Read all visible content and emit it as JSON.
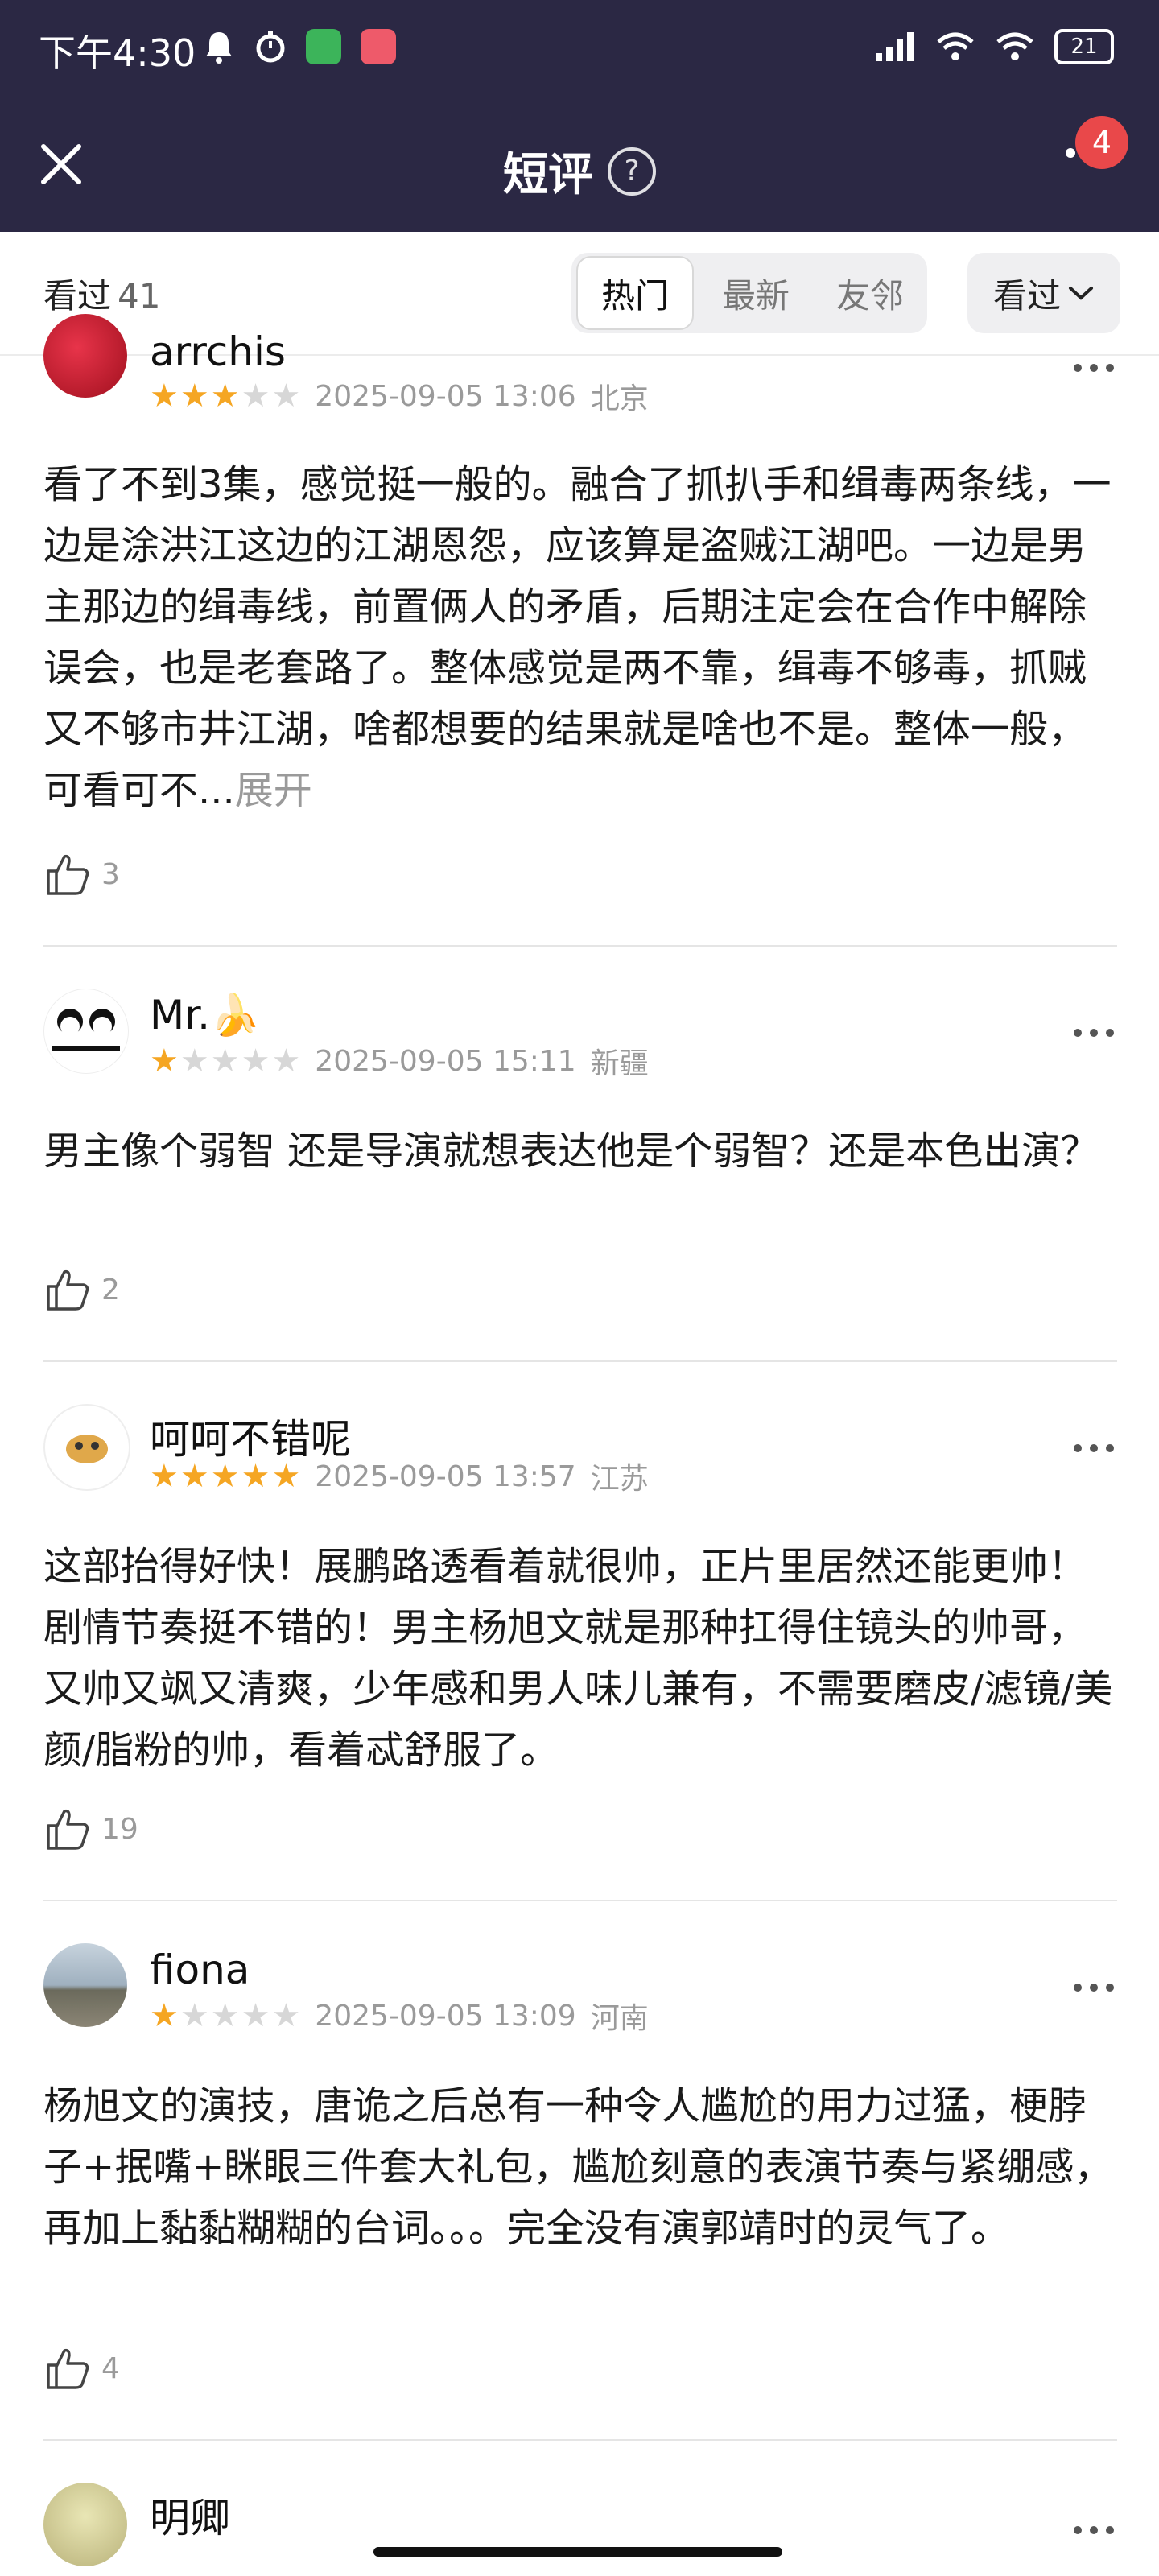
{
  "status_bar": {
    "time": "下午4:30",
    "battery": "21"
  },
  "header": {
    "title": "短评",
    "help": "?",
    "notification_count": "4"
  },
  "filter": {
    "seen_label": "看过",
    "seen_count": "41",
    "tabs": [
      "热门",
      "最新",
      "友邻"
    ],
    "active_tab": "热门",
    "dropdown_label": "看过"
  },
  "reviews": [
    {
      "name": "arrchis",
      "rating": 3,
      "date": "2025-09-05 13:06",
      "location": "北京",
      "content": "看了不到3集，感觉挺一般的。融合了抓扒手和缉毒两条线，一边是涂洪江这边的江湖恩怨，应该算是盗贼江湖吧。一边是男主那边的缉毒线，前置俩人的矛盾，后期注定会在合作中解除误会，也是老套路了。整体感觉是两不靠，缉毒不够毒，抓贼又不够市井江湖，啥都想要的结果就是啥也不是。整体一般，可看可不...",
      "expand": "展开",
      "likes": "3"
    },
    {
      "name": "Mr.🍌",
      "rating": 1,
      "date": "2025-09-05 15:11",
      "location": "新疆",
      "content": "男主像个弱智 还是导演就想表达他是个弱智？还是本色出演？",
      "likes": "2"
    },
    {
      "name": "呵呵不错呢",
      "rating": 5,
      "date": "2025-09-05 13:57",
      "location": "江苏",
      "content": "这部抬得好快！展鹏路透看着就很帅，正片里居然还能更帅！剧情节奏挺不错的！男主杨旭文就是那种扛得住镜头的帅哥，又帅又飒又清爽，少年感和男人味儿兼有，不需要磨皮/滤镜/美颜/脂粉的帅，看着忒舒服了。",
      "likes": "19"
    },
    {
      "name": "fiona",
      "rating": 1,
      "date": "2025-09-05 13:09",
      "location": "河南",
      "content": "杨旭文的演技，唐诡之后总有一种令人尴尬的用力过猛，梗脖子+抿嘴+眯眼三件套大礼包，尴尬刻意的表演节奏与紧绷感，再加上黏黏糊糊的台词。。。完全没有演郭靖时的灵气了。",
      "likes": "4"
    },
    {
      "name": "明卿"
    }
  ],
  "colors": {
    "header_bg": "#2b2844",
    "star_on": "#f5a623",
    "star_off": "#d7d7d7",
    "badge": "#e9484a"
  }
}
